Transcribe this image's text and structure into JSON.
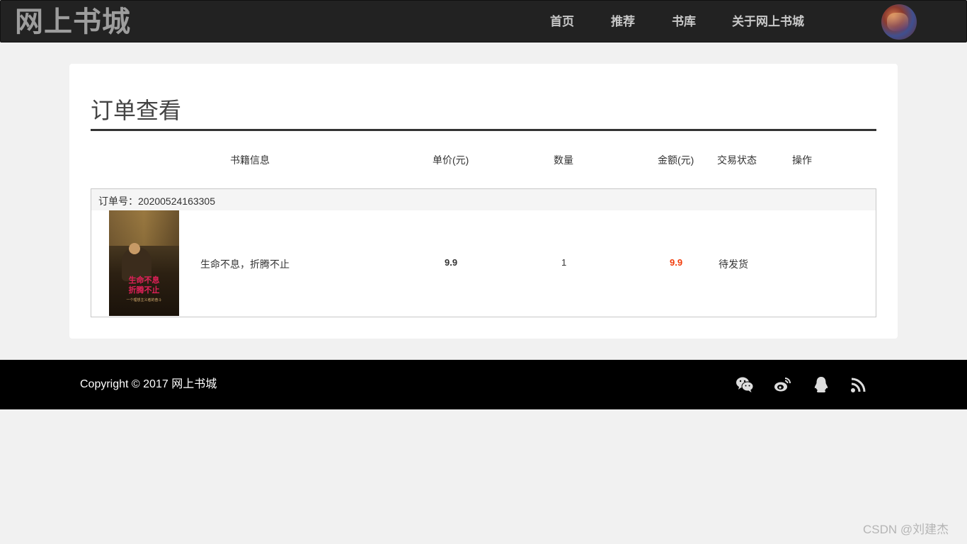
{
  "header": {
    "brand": "网上书城",
    "nav": [
      "首页",
      "推荐",
      "书库",
      "关于网上书城"
    ]
  },
  "main": {
    "title": "订单查看",
    "columns": [
      "书籍信息",
      "单价(元)",
      "数量",
      "金额(元)",
      "交易状态",
      "操作"
    ],
    "order": {
      "number_label": "订单号：20200524163305",
      "book": {
        "cover_title_line1": "生命不息",
        "cover_title_line2": "折腾不止",
        "cover_subtitle": "一个理想主义者的奋斗",
        "name": "生命不息，折腾不止",
        "price": "9.9",
        "quantity": "1",
        "amount": "9.9",
        "status": "待发货"
      }
    }
  },
  "footer": {
    "copyright": "Copyright © 2017 网上书城",
    "social_icons": [
      "wechat-icon",
      "weibo-icon",
      "qq-icon",
      "rss-icon"
    ]
  },
  "watermark": "CSDN @刘建杰",
  "colors": {
    "topbar": "#222222",
    "footer": "#000000",
    "amount": "#f23c0a",
    "cover_title": "#e3205a"
  }
}
